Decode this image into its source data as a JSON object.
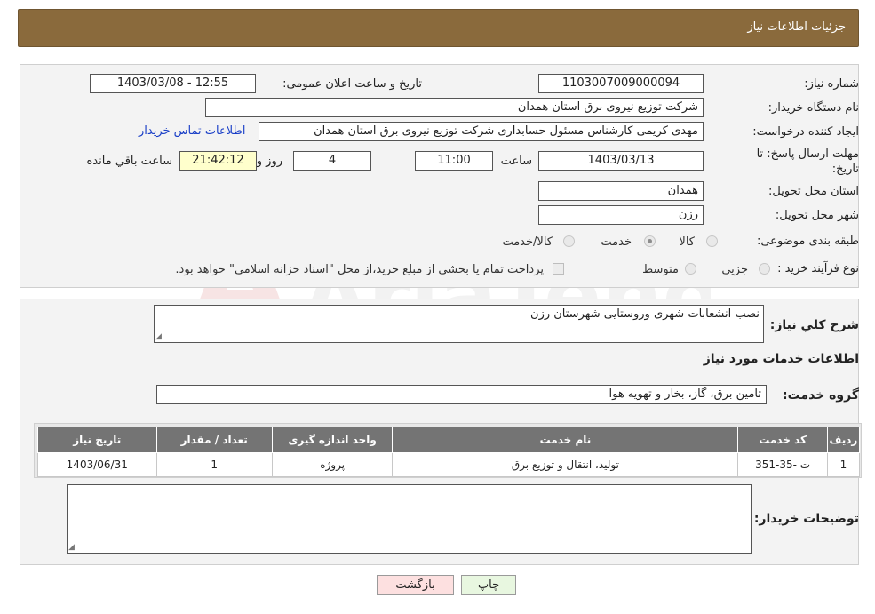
{
  "header": {
    "title": "جزئیات اطلاعات نیاز"
  },
  "form": {
    "need_number_label": "شماره نیاز:",
    "need_number_value": "1103007009000094",
    "announce_label": "تاریخ و ساعت اعلان عمومی:",
    "announce_value": "1403/03/08 - 12:55",
    "buyer_org_label": "نام دستگاه خریدار:",
    "buyer_org_value": "شرکت توزیع نیروی برق استان همدان",
    "creator_label": "ایجاد کننده درخواست:",
    "creator_value": "مهدی کریمی کارشناس مسئول حسابداری شرکت توزیع نیروی برق استان همدان",
    "contact_link": "اطلاعات تماس خریدار",
    "deadline_label_1": "مهلت ارسال پاسخ: تا",
    "deadline_label_2": "تاریخ:",
    "deadline_date": "1403/03/13",
    "time_label": "ساعت",
    "deadline_time": "11:00",
    "days_value": "4",
    "days_label": "روز و",
    "remaining_value": "21:42:12",
    "remaining_label": "ساعت باقي مانده",
    "province_label": "استان محل تحویل:",
    "province_value": "همدان",
    "city_label": "شهر محل تحویل:",
    "city_value": "رزن",
    "category_label": "طبقه بندی موضوعی:",
    "category_options": [
      "کالا",
      "خدمت",
      "کالا/خدمت"
    ],
    "category_selected": "خدمت",
    "process_label": "نوع فرآیند خرید :",
    "process_options": [
      "جزیی",
      "متوسط"
    ],
    "payment_note": "پرداخت تمام یا بخشی از مبلغ خرید،از محل \"اسناد خزانه اسلامی\" خواهد بود."
  },
  "summary": {
    "label": "شرح کلي نیاز:",
    "value": "نصب انشعابات شهری وروستایی شهرستان رزن",
    "services_title": "اطلاعات خدمات مورد نیاز",
    "group_label": "گروه خدمت:",
    "group_value": "تامین برق، گاز، بخار و تهویه هوا"
  },
  "table": {
    "headers": [
      "ردیف",
      "کد خدمت",
      "نام خدمت",
      "واحد اندازه گیری",
      "تعداد / مقدار",
      "تاریخ نیاز"
    ],
    "rows": [
      {
        "row": "1",
        "code": "ت -35-351",
        "name": "تولید، انتقال و توزیع برق",
        "unit": "پروژه",
        "qty": "1",
        "date": "1403/06/31"
      }
    ]
  },
  "notes": {
    "label": "توضیحات خریدار:",
    "value": ""
  },
  "buttons": {
    "print": "چاپ",
    "back": "بازگشت"
  },
  "colors": {
    "header_bg": "#8a6a3c",
    "table_header_bg": "#747474",
    "back_button_bg": "#fde0e0",
    "print_button_bg": "#e8f7e0"
  }
}
